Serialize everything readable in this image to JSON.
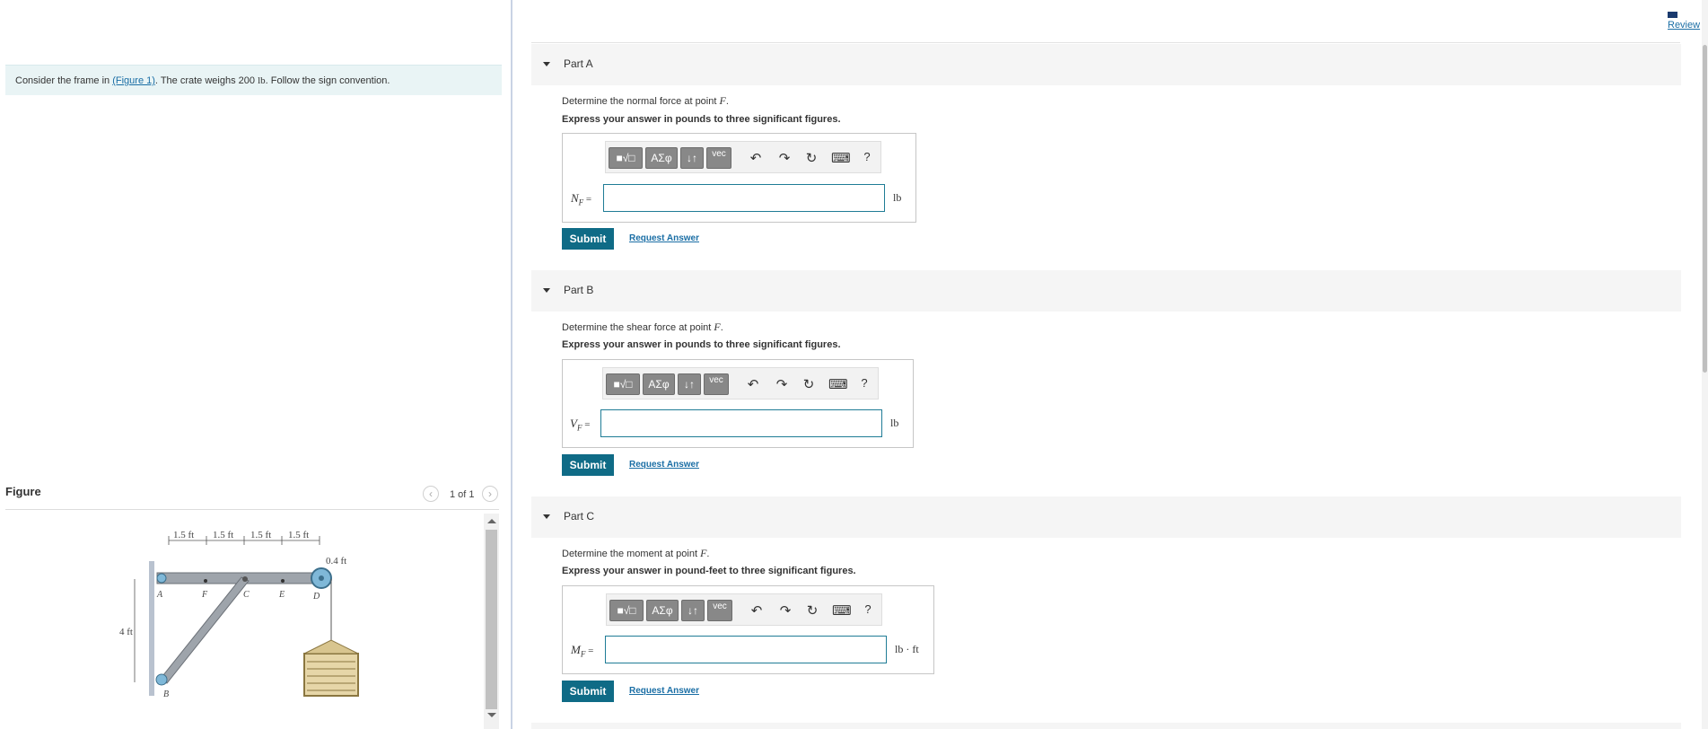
{
  "intro": {
    "prefix": "Consider the frame in ",
    "link": "(Figure 1)",
    "middle": ". The crate weighs 200 ",
    "unit": "lb",
    "suffix": ". Follow the sign convention."
  },
  "figure": {
    "title": "Figure",
    "pager": "1 of 1",
    "prev_icon": "chevron-left-icon",
    "next_icon": "chevron-right-icon",
    "dims": [
      "1.5 ft",
      "1.5 ft",
      "1.5 ft",
      "1.5 ft"
    ],
    "radius": "0.4 ft",
    "height": "4 ft",
    "points": {
      "A": "A",
      "F": "F",
      "C": "C",
      "E": "E",
      "D": "D",
      "B": "B"
    }
  },
  "review": "Review",
  "toolbar": {
    "templates": "■√□",
    "greek": "AΣφ",
    "arrows": "↓↑",
    "vec": "vec",
    "undo": "↶",
    "redo": "↷",
    "reset": "↻",
    "keyboard": "⌨",
    "help": "?"
  },
  "parts": [
    {
      "label": "Part A",
      "question": "Determine the normal force at point ",
      "point": "F",
      "express": "Express your answer in pounds to three significant figures.",
      "var": "N",
      "sub": "F",
      "eq": " =",
      "value": "",
      "unit": "lb",
      "submit": "Submit",
      "request": "Request Answer"
    },
    {
      "label": "Part B",
      "question": "Determine the shear force at point ",
      "point": "F",
      "express": "Express your answer in pounds to three significant figures.",
      "var": "V",
      "sub": "F",
      "eq": " =",
      "value": "",
      "unit": "lb",
      "submit": "Submit",
      "request": "Request Answer"
    },
    {
      "label": "Part C",
      "question": "Determine the moment at point ",
      "point": "F",
      "express": "Express your answer in pound-feet to three significant figures.",
      "var": "M",
      "sub": "F",
      "eq": " =",
      "value": "",
      "unit": "lb · ft",
      "submit": "Submit",
      "request": "Request Answer"
    }
  ]
}
